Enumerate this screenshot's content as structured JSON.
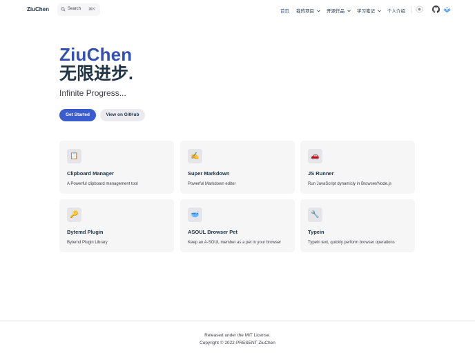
{
  "nav": {
    "brand": "ZiuChen",
    "search": {
      "label": "Search",
      "shortcut": "⌘K"
    },
    "items": [
      {
        "label": "首页",
        "active": true,
        "dropdown": false
      },
      {
        "label": "我的项目",
        "active": false,
        "dropdown": true
      },
      {
        "label": "开源作品",
        "active": false,
        "dropdown": true
      },
      {
        "label": "学习笔记",
        "active": false,
        "dropdown": true
      },
      {
        "label": "个人介绍",
        "active": false,
        "dropdown": false
      }
    ],
    "icons": [
      "theme-toggle-icon",
      "github-icon",
      "juejin-icon"
    ]
  },
  "hero": {
    "name": "ZiuChen",
    "text": "无限进步.",
    "tagline": "Infinite Progress...",
    "primary_action": "Get Started",
    "secondary_action": "View on GitHub"
  },
  "features": [
    {
      "icon": "📋",
      "title": "Clipboard Manager",
      "details": "A Powerful clipboard management tool"
    },
    {
      "icon": "✍️",
      "title": "Super Markdown",
      "details": "Powerful Markdown editor"
    },
    {
      "icon": "🚗",
      "title": "JS Runner",
      "details": "Run JavaScript dynamicly in Browser/Node.js"
    },
    {
      "icon": "🔑",
      "title": "Bytemd Plugin",
      "details": "Bytemd Plugin Library"
    },
    {
      "icon": "🥣",
      "title": "ASOUL Browser Pet",
      "details": "Keep an A-SOUL member as a pet in your browser"
    },
    {
      "icon": "🔧",
      "title": "Typein",
      "details": "Typein text, quickly perform browser operations"
    }
  ],
  "footer": {
    "message": "Released under the MIT License.",
    "copyright": "Copyright © 2022-PRESENT ZiuChen"
  },
  "colors": {
    "brand": "#3451b2",
    "button": "#3a5ccc",
    "card_bg": "#f6f6f7"
  }
}
